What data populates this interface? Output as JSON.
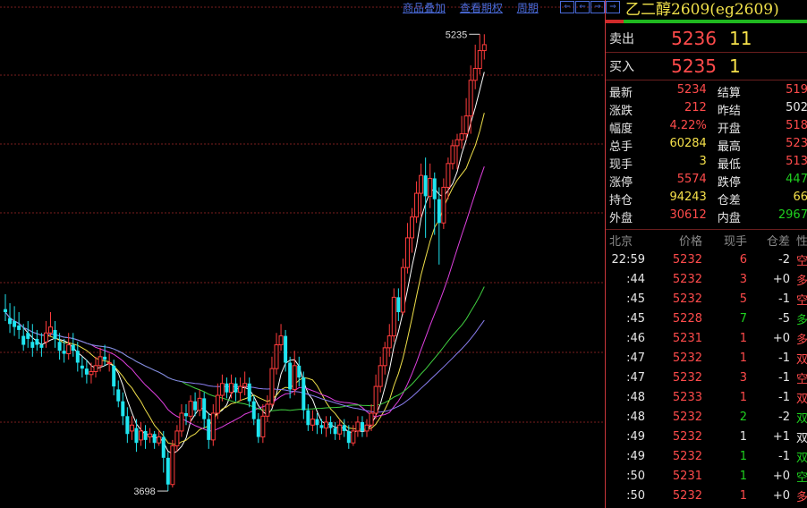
{
  "top_links": [
    "商品叠加",
    "查看期权",
    "周期"
  ],
  "nav_buttons": [
    "⇐",
    "⇐",
    "⇒",
    "⇒"
  ],
  "colors": {
    "up": "#ff3c3c",
    "down": "#1fe5f0",
    "ma1": "#ffffff",
    "ma2": "#f0e04a",
    "ma3": "#e040e0",
    "ma4": "#40d040",
    "ma5": "#8a7ef0",
    "grid": "#7a1e1e"
  },
  "chart_data": {
    "type": "candlestick",
    "ylim": [
      3650,
      5290
    ],
    "labels": {
      "high": "5235",
      "low": "3698"
    },
    "candles": [
      [
        4310,
        4300,
        4360,
        4270
      ],
      [
        4280,
        4260,
        4330,
        4230
      ],
      [
        4270,
        4250,
        4320,
        4220
      ],
      [
        4255,
        4240,
        4300,
        4210
      ],
      [
        4220,
        4190,
        4260,
        4170
      ],
      [
        4230,
        4210,
        4270,
        4180
      ],
      [
        4200,
        4180,
        4260,
        4150
      ],
      [
        4210,
        4190,
        4240,
        4170
      ],
      [
        4190,
        4180,
        4230,
        4150
      ],
      [
        4200,
        4230,
        4270,
        4180
      ],
      [
        4230,
        4250,
        4300,
        4220
      ],
      [
        4240,
        4210,
        4270,
        4180
      ],
      [
        4200,
        4170,
        4230,
        4140
      ],
      [
        4170,
        4160,
        4210,
        4130
      ],
      [
        4160,
        4190,
        4230,
        4140
      ],
      [
        4190,
        4170,
        4230,
        4150
      ],
      [
        4170,
        4130,
        4200,
        4100
      ],
      [
        4120,
        4110,
        4150,
        4080
      ],
      [
        4110,
        4090,
        4140,
        4060
      ],
      [
        4090,
        4100,
        4130,
        4060
      ],
      [
        4100,
        4120,
        4150,
        4080
      ],
      [
        4120,
        4150,
        4180,
        4100
      ],
      [
        4150,
        4140,
        4190,
        4120
      ],
      [
        4130,
        4130,
        4160,
        4100
      ],
      [
        4120,
        4050,
        4140,
        4020
      ],
      [
        4040,
        4000,
        4070,
        3980
      ],
      [
        4000,
        3950,
        4030,
        3920
      ],
      [
        3950,
        3890,
        3980,
        3860
      ],
      [
        3900,
        3920,
        3950,
        3870
      ],
      [
        3910,
        3860,
        3940,
        3830
      ],
      [
        3870,
        3900,
        3930,
        3850
      ],
      [
        3900,
        3870,
        3920,
        3840
      ],
      [
        3880,
        3890,
        3910,
        3860
      ],
      [
        3890,
        3860,
        3900,
        3840
      ],
      [
        3860,
        3880,
        3900,
        3850
      ],
      [
        3880,
        3810,
        3900,
        3760
      ],
      [
        3810,
        3720,
        3830,
        3698
      ],
      [
        3720,
        3850,
        3870,
        3710
      ],
      [
        3850,
        3900,
        3920,
        3830
      ],
      [
        3900,
        3960,
        3990,
        3880
      ],
      [
        3960,
        3950,
        3990,
        3920
      ],
      [
        3950,
        4000,
        4020,
        3930
      ],
      [
        4000,
        3970,
        4030,
        3950
      ],
      [
        3970,
        4010,
        4040,
        3950
      ],
      [
        4010,
        3940,
        4030,
        3910
      ],
      [
        3940,
        3870,
        3960,
        3840
      ],
      [
        3870,
        3960,
        3990,
        3850
      ],
      [
        3960,
        4020,
        4060,
        3940
      ],
      [
        4020,
        4060,
        4090,
        4000
      ],
      [
        4060,
        4030,
        4080,
        4010
      ],
      [
        4030,
        4060,
        4090,
        4010
      ],
      [
        4060,
        4030,
        4080,
        4000
      ],
      [
        4030,
        4050,
        4080,
        4000
      ],
      [
        4050,
        4060,
        4100,
        4020
      ],
      [
        4060,
        4000,
        4080,
        3980
      ],
      [
        4000,
        3940,
        4020,
        3920
      ],
      [
        3940,
        3880,
        3960,
        3860
      ],
      [
        3880,
        3950,
        3990,
        3860
      ],
      [
        3950,
        3990,
        4020,
        3930
      ],
      [
        3990,
        4110,
        4150,
        3980
      ],
      [
        4110,
        4190,
        4230,
        4090
      ],
      [
        4190,
        4220,
        4260,
        4170
      ],
      [
        4220,
        4130,
        4240,
        4100
      ],
      [
        4130,
        4040,
        4150,
        4010
      ],
      [
        4040,
        4120,
        4170,
        4020
      ],
      [
        4120,
        4080,
        4150,
        4050
      ],
      [
        4080,
        3970,
        4100,
        3940
      ],
      [
        3970,
        3920,
        3990,
        3900
      ],
      [
        3920,
        3940,
        3970,
        3900
      ],
      [
        3940,
        3920,
        3960,
        3890
      ],
      [
        3920,
        3910,
        3940,
        3890
      ],
      [
        3910,
        3930,
        3950,
        3880
      ],
      [
        3930,
        3910,
        3950,
        3890
      ],
      [
        3910,
        3890,
        3930,
        3870
      ],
      [
        3890,
        3920,
        3940,
        3870
      ],
      [
        3920,
        3900,
        3940,
        3880
      ],
      [
        3900,
        3860,
        3920,
        3840
      ],
      [
        3860,
        3900,
        3920,
        3850
      ],
      [
        3900,
        3930,
        3950,
        3880
      ],
      [
        3930,
        3900,
        3950,
        3880
      ],
      [
        3900,
        3920,
        3940,
        3880
      ],
      [
        3920,
        3960,
        3990,
        3900
      ],
      [
        3960,
        4050,
        4090,
        3940
      ],
      [
        4050,
        4120,
        4150,
        4030
      ],
      [
        4120,
        4180,
        4200,
        4090
      ],
      [
        4180,
        4220,
        4260,
        4150
      ],
      [
        4220,
        4350,
        4380,
        4200
      ],
      [
        4350,
        4300,
        4380,
        4270
      ],
      [
        4300,
        4450,
        4480,
        4290
      ],
      [
        4450,
        4550,
        4600,
        4430
      ],
      [
        4550,
        4620,
        4650,
        4500
      ],
      [
        4620,
        4700,
        4740,
        4600
      ],
      [
        4700,
        4760,
        4800,
        4620
      ],
      [
        4760,
        4690,
        4820,
        4550
      ],
      [
        4690,
        4750,
        4800,
        4650
      ],
      [
        4750,
        4680,
        4770,
        4560
      ],
      [
        4680,
        4600,
        4720,
        4460
      ],
      [
        4600,
        4720,
        4750,
        4580
      ],
      [
        4720,
        4800,
        4820,
        4680
      ],
      [
        4800,
        4860,
        4880,
        4780
      ],
      [
        4860,
        4880,
        4900,
        4780
      ],
      [
        4880,
        4900,
        4960,
        4850
      ],
      [
        4900,
        4960,
        5020,
        4880
      ],
      [
        4960,
        5080,
        5130,
        4900
      ],
      [
        5080,
        5120,
        5200,
        5050
      ],
      [
        5120,
        5180,
        5235,
        5100
      ],
      [
        5180,
        5200,
        5235,
        5150
      ]
    ],
    "ma_series": [
      {
        "period": 5,
        "color": "#ffffff"
      },
      {
        "period": 10,
        "color": "#f0e04a"
      },
      {
        "period": 20,
        "color": "#e040e0"
      },
      {
        "period": 40,
        "color": "#40d040"
      },
      {
        "period": 60,
        "color": "#8a7ef0"
      }
    ]
  },
  "panel": {
    "title": "乙二醇2609(eg2609)",
    "sell": {
      "label": "卖出",
      "price": "5236",
      "qty": "11"
    },
    "buy": {
      "label": "买入",
      "price": "5235",
      "qty": "1"
    },
    "stats": [
      {
        "l1": "最新",
        "v1": "5234",
        "c1": "#ff4b4b",
        "l2": "结算",
        "v2": "519",
        "c2": "#ff4b4b"
      },
      {
        "l1": "涨跌",
        "v1": "212",
        "c1": "#ff4b4b",
        "l2": "昨结",
        "v2": "502",
        "c2": "#e6e6e6"
      },
      {
        "l1": "幅度",
        "v1": "4.22%",
        "c1": "#ff4b4b",
        "l2": "开盘",
        "v2": "518",
        "c2": "#ff4b4b"
      },
      {
        "l1": "总手",
        "v1": "60284",
        "c1": "#f5e04a",
        "l2": "最高",
        "v2": "523",
        "c2": "#ff4b4b"
      },
      {
        "l1": "现手",
        "v1": "3",
        "c1": "#f5e04a",
        "l2": "最低",
        "v2": "513",
        "c2": "#ff4b4b"
      },
      {
        "l1": "涨停",
        "v1": "5574",
        "c1": "#ff4b4b",
        "l2": "跌停",
        "v2": "447",
        "c2": "#1fd01f"
      },
      {
        "l1": "持仓",
        "v1": "94243",
        "c1": "#f5e04a",
        "l2": "仓差",
        "v2": "66",
        "c2": "#f5e04a"
      },
      {
        "l1": "外盘",
        "v1": "30612",
        "c1": "#ff4b4b",
        "l2": "内盘",
        "v2": "2967",
        "c2": "#1fd01f"
      }
    ],
    "ticks_header": [
      "北京",
      "价格",
      "现手",
      "仓差",
      "性"
    ],
    "ticks": [
      {
        "time": "22:59",
        "price": "5232",
        "vol": "6",
        "vc": "#ff4b4b",
        "oi": "-2",
        "nat": "空",
        "nc": "#ff4b4b"
      },
      {
        "time": ":44",
        "price": "5232",
        "vol": "3",
        "vc": "#ff4b4b",
        "oi": "+0",
        "nat": "多",
        "nc": "#ff4b4b"
      },
      {
        "time": ":45",
        "price": "5232",
        "vol": "5",
        "vc": "#ff4b4b",
        "oi": "-1",
        "nat": "空",
        "nc": "#ff4b4b"
      },
      {
        "time": ":45",
        "price": "5228",
        "vol": "7",
        "vc": "#1fd01f",
        "oi": "-5",
        "nat": "多",
        "nc": "#1fd01f"
      },
      {
        "time": ":46",
        "price": "5231",
        "vol": "1",
        "vc": "#ff4b4b",
        "oi": "+0",
        "nat": "多",
        "nc": "#ff4b4b"
      },
      {
        "time": ":47",
        "price": "5232",
        "vol": "1",
        "vc": "#ff4b4b",
        "oi": "-1",
        "nat": "双",
        "nc": "#ff4b4b"
      },
      {
        "time": ":47",
        "price": "5232",
        "vol": "3",
        "vc": "#ff4b4b",
        "oi": "-1",
        "nat": "空",
        "nc": "#ff4b4b"
      },
      {
        "time": ":48",
        "price": "5233",
        "vol": "1",
        "vc": "#ff4b4b",
        "oi": "-1",
        "nat": "双",
        "nc": "#ff4b4b"
      },
      {
        "time": ":48",
        "price": "5232",
        "vol": "2",
        "vc": "#1fd01f",
        "oi": "-2",
        "nat": "双",
        "nc": "#1fd01f"
      },
      {
        "time": ":49",
        "price": "5232",
        "vol": "1",
        "vc": "#e6e6e6",
        "oi": "+1",
        "nat": "双",
        "nc": "#e6e6e6"
      },
      {
        "time": ":49",
        "price": "5232",
        "vol": "1",
        "vc": "#1fd01f",
        "oi": "-1",
        "nat": "双",
        "nc": "#1fd01f"
      },
      {
        "time": ":50",
        "price": "5231",
        "vol": "1",
        "vc": "#1fd01f",
        "oi": "+0",
        "nat": "空",
        "nc": "#1fd01f"
      },
      {
        "time": ":50",
        "price": "5232",
        "vol": "1",
        "vc": "#ff4b4b",
        "oi": "+0",
        "nat": "多",
        "nc": "#ff4b4b"
      }
    ]
  }
}
